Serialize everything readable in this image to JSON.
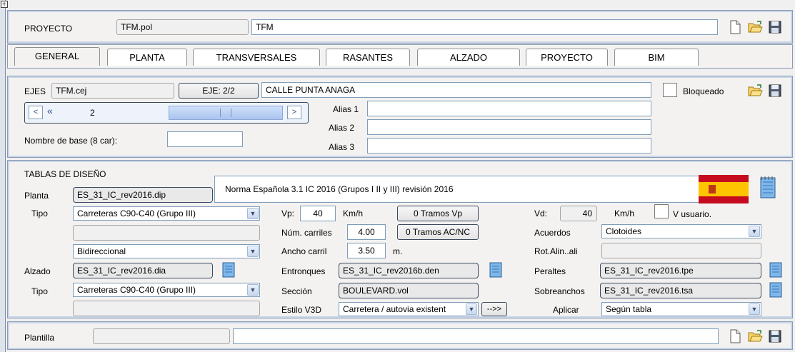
{
  "proyecto": {
    "label": "PROYECTO",
    "file": "TFM.pol",
    "name": "TFM"
  },
  "tabs": [
    "GENERAL",
    "PLANTA",
    "TRANSVERSALES",
    "RASANTES",
    "ALZADO",
    "PROYECTO",
    "BIM"
  ],
  "ejes": {
    "label": "EJES",
    "file": "TFM.cej",
    "eje_button": "EJE: 2/2",
    "name": "CALLE PUNTA ANAGA",
    "bloqueado_label": "Bloqueado",
    "nav_value": "2",
    "alias_labels": [
      "Alias 1",
      "Alias 2",
      "Alias 3"
    ],
    "alias_values": [
      "",
      "",
      ""
    ],
    "nombre_base_label": "Nombre de base (8 car):",
    "nombre_base_value": ""
  },
  "tablas": {
    "title": "TABLAS DE DISEÑO",
    "norma": "Norma Española 3.1 IC 2016 (Grupos I II y III) revisión 2016",
    "planta_label": "Planta",
    "planta_file": "ES_31_IC_rev2016.dip",
    "tipo_label": "Tipo",
    "tipo_value": "Carreteras C90-C40 (Grupo III)",
    "tipo_blank": "",
    "direccion_value": "Bidireccional",
    "alzado_label": "Alzado",
    "alzado_file": "ES_31_IC_rev2016.dia",
    "tipo2_label": "Tipo",
    "tipo2_value": "Carreteras C90-C40 (Grupo III)",
    "tipo2_blank": "",
    "vp_label": "Vp:",
    "vp_value": "40",
    "vp_unit": "Km/h",
    "tramos_vp": "0 Tramos Vp",
    "carriles_label": "Núm. carriles",
    "carriles_value": "4.00",
    "tramos_acnc": "0 Tramos AC/NC",
    "ancho_label": "Ancho carril",
    "ancho_value": "3.50",
    "ancho_unit": "m.",
    "entronques_label": "Entronques",
    "entronques_value": "ES_31_IC_rev2016b.den",
    "seccion_label": "Sección",
    "seccion_value": "BOULEVARD.vol",
    "estilo_label": "Estilo V3D",
    "estilo_value": "Carretera / autovia existent",
    "estilo_button": "-->>",
    "vd_label": "Vd:",
    "vd_value": "40",
    "vd_unit": "Km/h",
    "vusuario_label": "V usuario.",
    "acuerdos_label": "Acuerdos",
    "acuerdos_value": "Clotoides",
    "rotalin_label": "Rot.Alin..ali",
    "rotalin_value": "",
    "peraltes_label": "Peraltes",
    "peraltes_value": "ES_31_IC_rev2016.tpe",
    "sobreanchos_label": "Sobreanchos",
    "sobreanchos_value": "ES_31_IC_rev2016.tsa",
    "aplicar_label": "Aplicar",
    "aplicar_value": "Según tabla"
  },
  "plantilla": {
    "label": "Plantilla",
    "file": "",
    "name": ""
  },
  "icons": {
    "new": "new-document-icon",
    "open": "open-folder-icon",
    "save": "save-disk-icon",
    "flag": "spain-flag-icon",
    "notepad": "notepad-icon"
  },
  "colors": {
    "panel_border": "#8c9bb3",
    "panel_bg": "#f3f2f1",
    "flag_red": "#c60b1e",
    "flag_yellow": "#ffc400"
  }
}
